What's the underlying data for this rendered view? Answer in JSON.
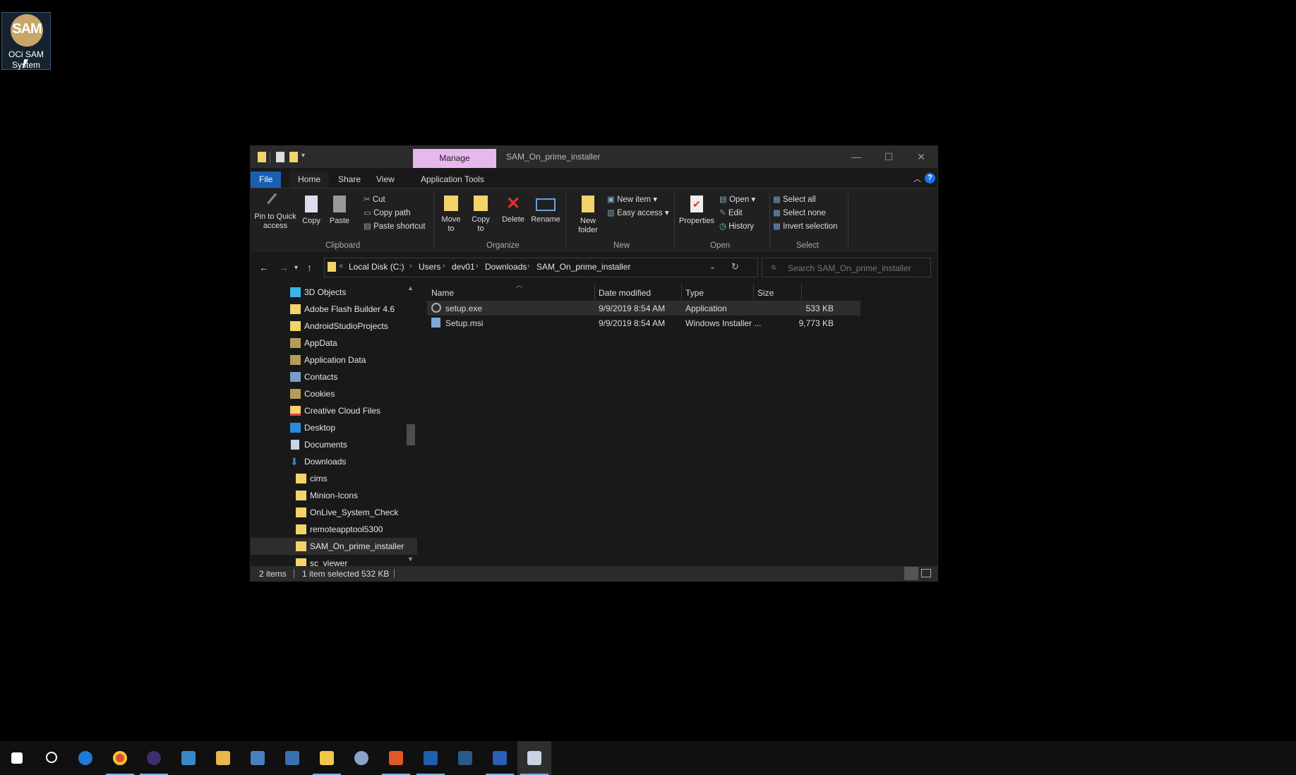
{
  "desktop": {
    "icon_logo": "SAM",
    "icon_label": "OCi SAM System"
  },
  "window": {
    "title": "SAM_On_prime_installer",
    "manage_label": "Manage",
    "controls": {
      "minimize": "—",
      "maximize": "☐",
      "close": "✕"
    }
  },
  "tabs": [
    "File",
    "Home",
    "Share",
    "View",
    "Application Tools"
  ],
  "ribbon": {
    "clipboard": {
      "pin": "Pin to Quick access",
      "copy": "Copy",
      "paste": "Paste",
      "cut": "Cut",
      "copy_path": "Copy path",
      "paste_shortcut": "Paste shortcut",
      "group": "Clipboard"
    },
    "organize": {
      "move_to": "Move to",
      "copy_to": "Copy to",
      "delete": "Delete",
      "rename": "Rename",
      "group": "Organize"
    },
    "new": {
      "new_folder": "New folder",
      "new_item": "New item",
      "easy_access": "Easy access",
      "group": "New"
    },
    "open": {
      "properties": "Properties",
      "open": "Open",
      "edit": "Edit",
      "history": "History",
      "group": "Open"
    },
    "select": {
      "select_all": "Select all",
      "select_none": "Select none",
      "invert": "Invert selection",
      "group": "Select"
    }
  },
  "address": {
    "crumbs": [
      "Local Disk (C:)",
      "Users",
      "dev01",
      "Downloads",
      "SAM_On_prime_installer"
    ],
    "search_placeholder": "Search SAM_On_prime_installer"
  },
  "nav": [
    {
      "label": "3D Objects",
      "icon": "3d-objects-icon"
    },
    {
      "label": "Adobe Flash Builder 4.6",
      "icon": "folder-icon"
    },
    {
      "label": "AndroidStudioProjects",
      "icon": "folder-icon"
    },
    {
      "label": "AppData",
      "icon": "folder-icon"
    },
    {
      "label": "Application Data",
      "icon": "shortcut-folder-icon"
    },
    {
      "label": "Contacts",
      "icon": "contacts-icon"
    },
    {
      "label": "Cookies",
      "icon": "shortcut-folder-icon"
    },
    {
      "label": "Creative Cloud Files",
      "icon": "cloud-folder-icon"
    },
    {
      "label": "Desktop",
      "icon": "desktop-icon"
    },
    {
      "label": "Documents",
      "icon": "documents-icon"
    },
    {
      "label": "Downloads",
      "icon": "downloads-icon"
    },
    {
      "label": "cims",
      "icon": "folder-icon"
    },
    {
      "label": "Minion-Icons",
      "icon": "folder-icon"
    },
    {
      "label": "OnLive_System_Check",
      "icon": "folder-icon"
    },
    {
      "label": "remoteapptool5300",
      "icon": "folder-icon"
    },
    {
      "label": "SAM_On_prime_installer",
      "icon": "folder-icon"
    },
    {
      "label": "sc_viewer",
      "icon": "folder-icon"
    }
  ],
  "columns": {
    "name": "Name",
    "date": "Date modified",
    "type": "Type",
    "size": "Size"
  },
  "files": [
    {
      "name": "setup.exe",
      "date": "9/9/2019 8:54 AM",
      "type": "Application",
      "size": "533 KB",
      "icon": "exe-icon"
    },
    {
      "name": "Setup.msi",
      "date": "9/9/2019 8:54 AM",
      "type": "Windows Installer ...",
      "size": "9,773 KB",
      "icon": "msi-icon"
    }
  ],
  "status": {
    "items": "2 items",
    "selected": "1 item selected",
    "size": "532 KB"
  },
  "colors": {
    "accent": "#1a5fb4",
    "manage": "#e6b8ec",
    "folder": "#f3d36b"
  },
  "taskbar": [
    "windows-start-icon",
    "search-icon",
    "edge-icon",
    "chrome-icon",
    "lock-app-icon",
    "network-app-icon",
    "tools-app-icon",
    "monitor-app-icon",
    "remote-app-icon",
    "file-explorer-icon",
    "people-app-icon",
    "office-app-icon",
    "oci-app-icon",
    "photos-app-icon",
    "word-icon",
    "capture-app-icon"
  ]
}
